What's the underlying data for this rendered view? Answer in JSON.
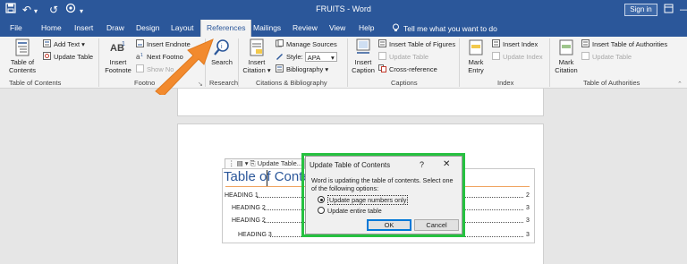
{
  "app": {
    "title": "FRUITS - Word",
    "signin": "Sign in"
  },
  "tabs": [
    "File",
    "Home",
    "Insert",
    "Draw",
    "Design",
    "Layout",
    "References",
    "Mailings",
    "Review",
    "View",
    "Help"
  ],
  "tell_me": "Tell me what you want to do",
  "ribbon": {
    "toc_group": {
      "toc_btn": "Table of Contents",
      "add_text": "Add Text",
      "update_table": "Update Table",
      "title": "Table of Contents"
    },
    "footnotes_group": {
      "insert_footnote": "Insert Footnote",
      "insert_endnote": "Insert Endnote",
      "next_footnote": "Next Footno",
      "show_notes": "Show No",
      "title": "Footno"
    },
    "research_group": {
      "search": "Search",
      "title": "Research"
    },
    "citations_group": {
      "insert_citation": "Insert Citation",
      "manage_sources": "Manage Sources",
      "style_label": "Style:",
      "style_value": "APA",
      "bibliography": "Bibliography",
      "title": "Citations & Bibliography"
    },
    "captions_group": {
      "insert_caption": "Insert Caption",
      "insert_table_of_figures": "Insert Table of Figures",
      "update_table": "Update Table",
      "cross_reference": "Cross-reference",
      "title": "Captions"
    },
    "index_group": {
      "mark_entry": "Mark Entry",
      "insert_index": "Insert Index",
      "update_index": "Update Index",
      "title": "Index"
    },
    "authorities_group": {
      "mark_citation": "Mark Citation",
      "insert_table_of_authorities": "Insert Table of Authorities",
      "update_table": "Update Table",
      "title": "Table of Authorities"
    }
  },
  "document": {
    "toc_toolbar_label": "Update Table...",
    "toc_title": "Table of Conte",
    "entries": [
      {
        "text": "HEADING 1",
        "page": "2"
      },
      {
        "text": "HEADING 2",
        "page": "3"
      },
      {
        "text": "HEADING 2",
        "page": "3"
      },
      {
        "text": "HEADING 3",
        "page": "3"
      }
    ]
  },
  "dialog": {
    "title": "Update Table of Contents",
    "help": "?",
    "close": "✕",
    "message": "Word is updating the table of contents.  Select one of the following options:",
    "options": [
      "Update page numbers only",
      "Update entire table"
    ],
    "selected": 0,
    "ok": "OK",
    "cancel": "Cancel"
  },
  "colors": {
    "title_bar": "#2b579a",
    "highlight": "#26c140",
    "arrow": "#f28a2e",
    "heading_blue": "#2b579a"
  },
  "icons": [
    "save-icon",
    "undo-icon",
    "redo-icon",
    "autosave-icon",
    "folder-icon",
    "customize-qat-icon",
    "ribbon-display-icon",
    "minimize-icon",
    "restore-icon",
    "close-icon",
    "lightbulb-icon"
  ]
}
